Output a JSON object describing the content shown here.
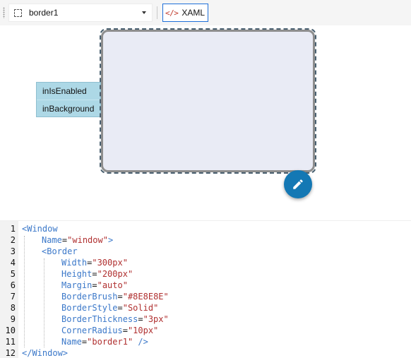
{
  "toolbar": {
    "selector_value": "border1",
    "xaml_icon": "</>",
    "xaml_label": "XAML"
  },
  "canvas": {
    "ports": [
      {
        "label": "inIsEnabled"
      },
      {
        "label": "inBackground"
      }
    ],
    "border_fill": "#e9ebf5",
    "border_brush": "#8e8e8e",
    "fab_color": "#1478b4",
    "fab_icon": "pencil-icon"
  },
  "editor": {
    "line_numbers": [
      "1",
      "2",
      "3",
      "4",
      "5",
      "6",
      "7",
      "8",
      "9",
      "10",
      "11",
      "12"
    ],
    "lines": [
      {
        "tag": "<Window"
      },
      {
        "attr": "Name",
        "eq": "=",
        "val": "\"window\"",
        "close": ">"
      },
      {
        "tag": "<Border"
      },
      {
        "attr": "Width",
        "eq": "=",
        "val": "\"300px\""
      },
      {
        "attr": "Height",
        "eq": "=",
        "val": "\"200px\""
      },
      {
        "attr": "Margin",
        "eq": "=",
        "val": "\"auto\""
      },
      {
        "attr": "BorderBrush",
        "eq": "=",
        "val": "\"#8E8E8E\""
      },
      {
        "attr": "BorderStyle",
        "eq": "=",
        "val": "\"Solid\""
      },
      {
        "attr": "BorderThickness",
        "eq": "=",
        "val": "\"3px\""
      },
      {
        "attr": "CornerRadius",
        "eq": "=",
        "val": "\"10px\""
      },
      {
        "attr": "Name",
        "eq": "=",
        "val": "\"border1\"",
        "close": " />"
      },
      {
        "tag": "</Window>"
      }
    ]
  }
}
